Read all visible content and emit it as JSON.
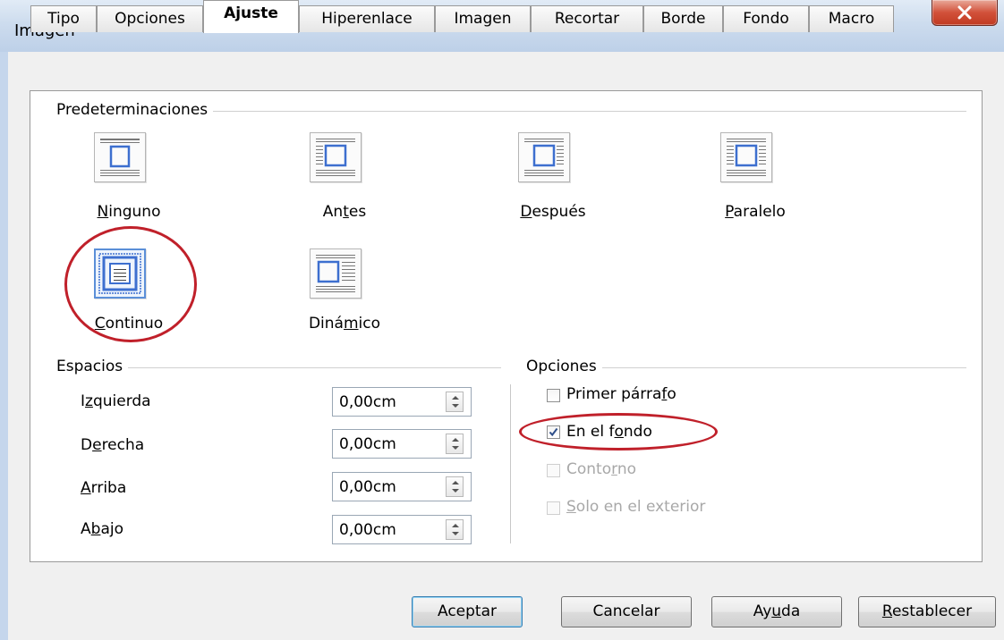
{
  "window": {
    "title": "Imagen",
    "close_symbol": "✕"
  },
  "tabs": [
    {
      "label": "Tipo"
    },
    {
      "label": "Opciones"
    },
    {
      "label": "Ajuste",
      "active": true
    },
    {
      "label": "Hiperenlace"
    },
    {
      "label": "Imagen"
    },
    {
      "label": "Recortar"
    },
    {
      "label": "Borde"
    },
    {
      "label": "Fondo"
    },
    {
      "label": "Macro"
    }
  ],
  "presets": {
    "group_title": "Predeterminaciones",
    "selected": "Continuo",
    "items": [
      {
        "prefix": "",
        "accel": "N",
        "suffix": "inguno",
        "icon": "wrap-none-icon"
      },
      {
        "prefix": "An",
        "accel": "t",
        "suffix": "es",
        "icon": "wrap-before-icon"
      },
      {
        "prefix": "",
        "accel": "D",
        "suffix": "espués",
        "icon": "wrap-after-icon"
      },
      {
        "prefix": "",
        "accel": "P",
        "suffix": "aralelo",
        "icon": "wrap-parallel-icon"
      },
      {
        "prefix": "",
        "accel": "C",
        "suffix": "ontinuo",
        "icon": "wrap-through-icon"
      },
      {
        "prefix": "Diná",
        "accel": "m",
        "suffix": "ico",
        "icon": "wrap-optimal-icon"
      }
    ]
  },
  "spacing": {
    "group_title": "Espacios",
    "fields": [
      {
        "prefix": "I",
        "accel": "z",
        "suffix": "quierda",
        "value": "0,00cm"
      },
      {
        "prefix": "D",
        "accel": "e",
        "suffix": "recha",
        "value": "0,00cm"
      },
      {
        "prefix": "",
        "accel": "A",
        "suffix": "rriba",
        "value": "0,00cm"
      },
      {
        "prefix": "A",
        "accel": "b",
        "suffix": "ajo",
        "value": "0,00cm"
      }
    ]
  },
  "options": {
    "group_title": "Opciones",
    "items": [
      {
        "prefix": "Primer párra",
        "accel": "f",
        "suffix": "o",
        "checked": false,
        "enabled": true
      },
      {
        "prefix": "En el f",
        "accel": "o",
        "suffix": "ndo",
        "checked": true,
        "enabled": true
      },
      {
        "prefix": "Conto",
        "accel": "r",
        "suffix": "no",
        "checked": false,
        "enabled": false
      },
      {
        "prefix": "",
        "accel": "S",
        "suffix": "olo en el exterior",
        "checked": false,
        "enabled": false
      }
    ]
  },
  "buttons": [
    {
      "prefix": "Aceptar",
      "accel": "",
      "suffix": "",
      "default": true
    },
    {
      "prefix": "Cancelar",
      "accel": "",
      "suffix": "",
      "default": false
    },
    {
      "prefix": "Ay",
      "accel": "u",
      "suffix": "da",
      "default": false
    },
    {
      "prefix": "",
      "accel": "R",
      "suffix": "establecer",
      "default": false
    }
  ],
  "annotation_color": "#c0202a",
  "accent_color": "#5b8fd8"
}
